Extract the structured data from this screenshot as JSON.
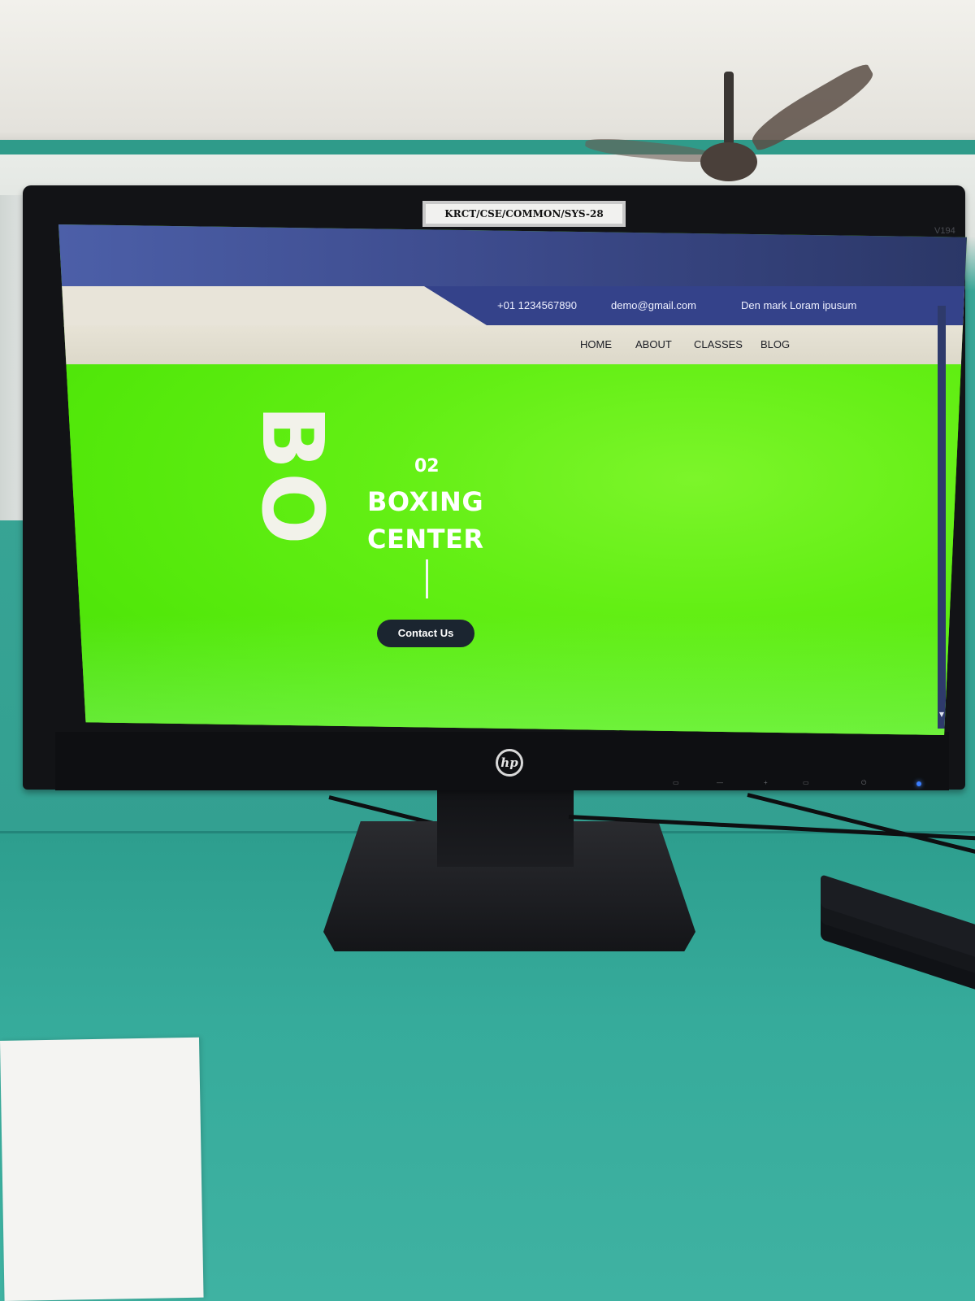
{
  "asset_label": "KRCT/CSE/COMMON/SYS-28",
  "monitor": {
    "brand_logo": "hp",
    "model": "V194"
  },
  "website": {
    "url": "",
    "header": {
      "phone": "+01 1234567890",
      "email": "demo@gmail.com",
      "address": "Den mark Loram ipusum"
    },
    "nav": [
      "HOME",
      "ABOUT",
      "CLASSES",
      "BLOG"
    ],
    "hero": {
      "watermark": "BO",
      "slide_number": "02",
      "title_line1": "BOXING",
      "title_line2": "CENTER",
      "cta_label": "Contact Us"
    },
    "colors": {
      "hero_green": "#5df000",
      "header_blue": "#34428a",
      "button_dark": "#1b2530"
    }
  }
}
